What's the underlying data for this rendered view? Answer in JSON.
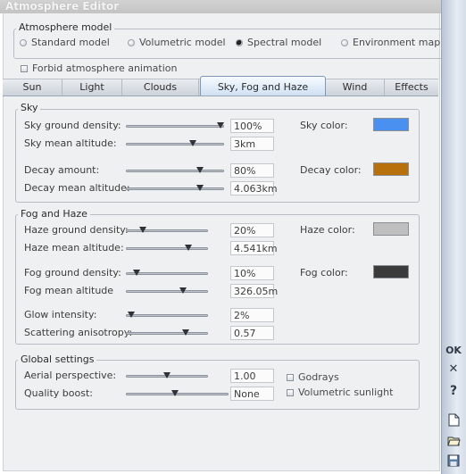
{
  "window": {
    "title": "Atmosphere Editor"
  },
  "atmosphere_model": {
    "legend": "Atmosphere model",
    "options": [
      {
        "label": "Standard model",
        "selected": false
      },
      {
        "label": "Volumetric model",
        "selected": false
      },
      {
        "label": "Spectral model",
        "selected": true
      },
      {
        "label": "Environment mapping",
        "selected": false
      }
    ]
  },
  "forbid_animation": {
    "label": "Forbid atmosphere animation",
    "checked": false
  },
  "tabs": [
    {
      "label": "Sun",
      "active": false
    },
    {
      "label": "Light",
      "active": false
    },
    {
      "label": "Clouds",
      "active": false
    },
    {
      "label": "Sky, Fog and Haze",
      "active": true
    },
    {
      "label": "Wind",
      "active": false
    },
    {
      "label": "Effects",
      "active": false
    }
  ],
  "sky": {
    "legend": "Sky",
    "rows": [
      {
        "label": "Sky ground density:",
        "value": "100%",
        "level": 1.0
      },
      {
        "label": "Sky mean altitude:",
        "value": "3km",
        "level": 0.7
      },
      {
        "label": "Decay amount:",
        "value": "80%",
        "level": 0.77
      },
      {
        "label": "Decay mean altitude:",
        "value": "4.063km",
        "level": 0.77
      }
    ],
    "colors": [
      {
        "label": "Sky color:",
        "color": "#4a90f0"
      },
      {
        "label": "Decay color:",
        "color": "#b8700c"
      }
    ]
  },
  "fog": {
    "legend": "Fog and Haze",
    "rows": [
      {
        "label": "Haze ground density:",
        "value": "20%",
        "level": 0.18
      },
      {
        "label": "Haze mean altitude:",
        "value": "4.541km",
        "level": 0.78
      },
      {
        "label": "Fog ground density:",
        "value": "10%",
        "level": 0.1
      },
      {
        "label": "Fog mean altitude",
        "value": "326.05m",
        "level": 0.72
      },
      {
        "label": "Glow intensity:",
        "value": "2%",
        "level": 0.02
      },
      {
        "label": "Scattering anisotropy:",
        "value": "0.57",
        "level": 0.75
      }
    ],
    "colors": [
      {
        "label": "Haze color:",
        "color": "#bfbfbf"
      },
      {
        "label": "Fog color:",
        "color": "#3b3b3b"
      }
    ]
  },
  "global": {
    "legend": "Global settings",
    "rows": [
      {
        "label": "Aerial perspective:",
        "value": "1.00",
        "level": 0.5
      },
      {
        "label": "Quality boost:",
        "value": "None",
        "level": 0.48
      }
    ],
    "checks": [
      {
        "label": "Godrays",
        "checked": false
      },
      {
        "label": "Volumetric sunlight",
        "checked": false
      }
    ]
  },
  "sidebar": {
    "ok_label": "OK",
    "close_symbol": "✕",
    "help_symbol": "?"
  }
}
